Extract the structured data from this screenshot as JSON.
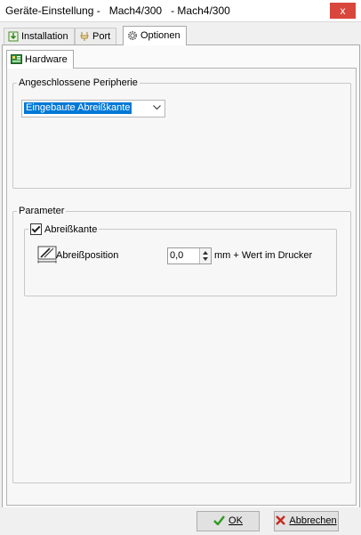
{
  "window": {
    "title": "Geräte-Einstellung -   Mach4/300   - Mach4/300",
    "close_symbol": "x"
  },
  "tabs": [
    {
      "label": "Installation",
      "icon": "installation-icon"
    },
    {
      "label": "Port",
      "icon": "port-icon"
    },
    {
      "label": "Optionen",
      "icon": "gear-icon",
      "active": true
    }
  ],
  "subtab": {
    "label": "Hardware",
    "icon": "hardware-icon"
  },
  "peripherals": {
    "legend": "Angeschlossene Peripherie",
    "combo_value": "Eingebaute Abreißkante"
  },
  "parameters": {
    "legend": "Parameter",
    "tear_group": {
      "label": "Abreißkante",
      "checked": true,
      "position_label": "Abreißposition",
      "position_value": "0,0",
      "unit_label": "mm + Wert im Drucker"
    }
  },
  "footer": {
    "ok_label": "OK",
    "cancel_label": "Abbrechen",
    "ok_color": "#2e9b1f",
    "cancel_color": "#c9281d"
  }
}
